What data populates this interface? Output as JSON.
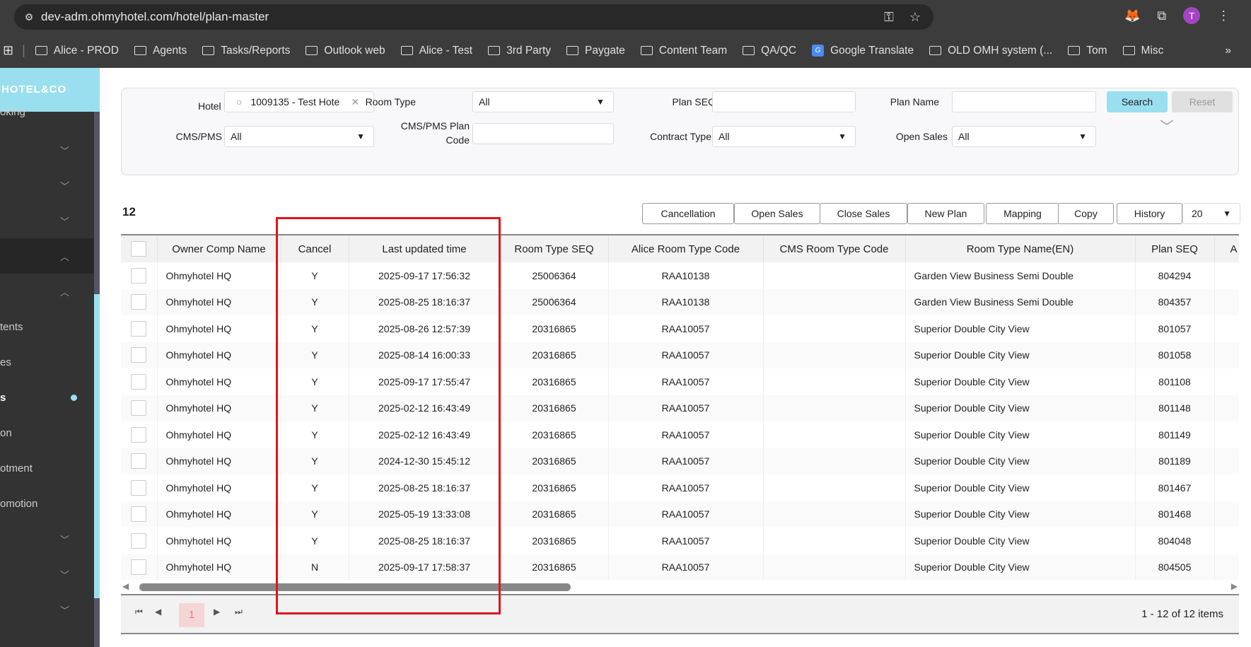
{
  "browser": {
    "url": "dev-adm.ohmyhotel.com/hotel/plan-master",
    "avatar": "T",
    "bookmarks": [
      "Alice - PROD",
      "Agents",
      "Tasks/Reports",
      "Outlook web",
      "Alice - Test",
      "3rd Party",
      "Paygate",
      "Content Team",
      "QA/QC",
      "Google Translate",
      "OLD OMH system (...",
      "Tom",
      "Misc"
    ]
  },
  "sidebar": {
    "logo": "HOTEL&CO",
    "items": [
      "oking",
      "tents",
      "es",
      "s",
      "on",
      "otment",
      "omotion"
    ]
  },
  "filters": {
    "hotel_label": "Hotel",
    "hotel_value": "1009135 - Test Hote",
    "room_type_label": "Room Type",
    "room_type_value": "All",
    "plan_seq_label": "Plan SEQ",
    "plan_name_label": "Plan Name",
    "cms_label": "CMS/PMS",
    "cms_value": "All",
    "cms_plan_code_label_1": "CMS/PMS Plan",
    "cms_plan_code_label_2": "Code",
    "contract_type_label": "Contract Type",
    "contract_type_value": "All",
    "open_sales_label": "Open Sales",
    "open_sales_value": "All",
    "search": "Search",
    "reset": "Reset"
  },
  "toolbar": {
    "count": "12",
    "buttons": [
      "Cancellation",
      "Open Sales",
      "Close Sales",
      "New Plan",
      "Mapping",
      "Copy",
      "History"
    ],
    "page_size": "20"
  },
  "table": {
    "headers": [
      "Owner Comp Name",
      "Cancel",
      "Last updated time",
      "Room Type SEQ",
      "Alice Room Type Code",
      "CMS Room Type Code",
      "Room Type Name(EN)",
      "Plan SEQ",
      "A"
    ],
    "rows": [
      [
        "Ohmyhotel HQ",
        "Y",
        "2025-09-17 17:56:32",
        "25006364",
        "RAA10138",
        "",
        "Garden View Business Semi Double",
        "804294"
      ],
      [
        "Ohmyhotel HQ",
        "Y",
        "2025-08-25 18:16:37",
        "25006364",
        "RAA10138",
        "",
        "Garden View Business Semi Double",
        "804357"
      ],
      [
        "Ohmyhotel HQ",
        "Y",
        "2025-08-26 12:57:39",
        "20316865",
        "RAA10057",
        "",
        "Superior Double City View",
        "801057"
      ],
      [
        "Ohmyhotel HQ",
        "Y",
        "2025-08-14 16:00:33",
        "20316865",
        "RAA10057",
        "",
        "Superior Double City View",
        "801058"
      ],
      [
        "Ohmyhotel HQ",
        "Y",
        "2025-09-17 17:55:47",
        "20316865",
        "RAA10057",
        "",
        "Superior Double City View",
        "801108"
      ],
      [
        "Ohmyhotel HQ",
        "Y",
        "2025-02-12 16:43:49",
        "20316865",
        "RAA10057",
        "",
        "Superior Double City View",
        "801148"
      ],
      [
        "Ohmyhotel HQ",
        "Y",
        "2025-02-12 16:43:49",
        "20316865",
        "RAA10057",
        "",
        "Superior Double City View",
        "801149"
      ],
      [
        "Ohmyhotel HQ",
        "Y",
        "2024-12-30 15:45:12",
        "20316865",
        "RAA10057",
        "",
        "Superior Double City View",
        "801189"
      ],
      [
        "Ohmyhotel HQ",
        "Y",
        "2025-08-25 18:16:37",
        "20316865",
        "RAA10057",
        "",
        "Superior Double City View",
        "801467"
      ],
      [
        "Ohmyhotel HQ",
        "Y",
        "2025-05-19 13:33:08",
        "20316865",
        "RAA10057",
        "",
        "Superior Double City View",
        "801468"
      ],
      [
        "Ohmyhotel HQ",
        "Y",
        "2025-08-25 18:16:37",
        "20316865",
        "RAA10057",
        "",
        "Superior Double City View",
        "804048"
      ],
      [
        "Ohmyhotel HQ",
        "N",
        "2025-09-17 17:58:37",
        "20316865",
        "RAA10057",
        "",
        "Superior Double City View",
        "804505"
      ]
    ]
  },
  "pager": {
    "current": "1",
    "summary": "1 - 12 of 12 items"
  },
  "colors": {
    "accent": "#9adff0",
    "highlight_box": "#e0141c",
    "sidebar_bg": "#333333"
  }
}
